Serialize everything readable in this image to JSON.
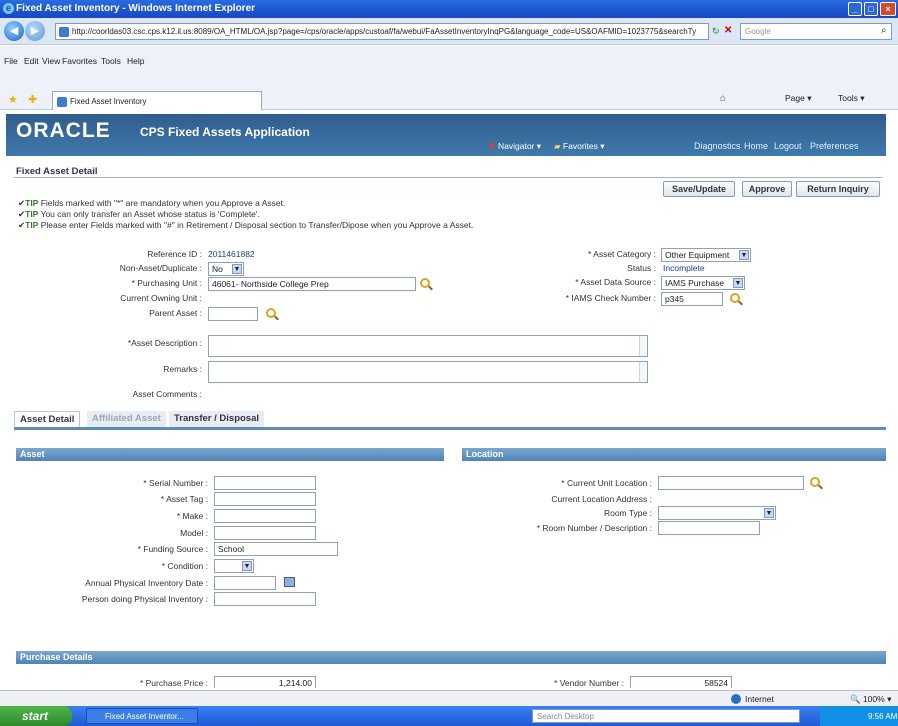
{
  "window": {
    "title": "Fixed Asset Inventory - Windows Internet Explorer"
  },
  "browser": {
    "url": "http://coorldas03.csc.cps.k12.il.us:8089/OA_HTML/OA.jsp?page=/cps/oracle/apps/custoaf/fa/webui/FaAssetInventoryInqPG&language_code=US&OAFMID=1023775&searchTy",
    "search_placeholder": "Google",
    "menu": [
      "File",
      "Edit",
      "View",
      "Favorites",
      "Tools",
      "Help"
    ],
    "tab_label": "Fixed Asset Inventory",
    "cmd_page": "Page",
    "cmd_tools": "Tools"
  },
  "banner": {
    "logo": "ORACLE",
    "app_name": "CPS Fixed Assets Application",
    "navigator": "Navigator",
    "favorites": "Favorites",
    "links": [
      "Diagnostics",
      "Home",
      "Logout",
      "Preferences"
    ]
  },
  "page": {
    "title": "Fixed Asset Detail",
    "buttons": {
      "save": "Save/Update",
      "approve": "Approve",
      "return": "Return Inquiry"
    },
    "tips": [
      {
        "tag": "TIP",
        "text": " Fields marked with \"*\" are mandatory when you Approve a Asset."
      },
      {
        "tag": "TIP",
        "text": " You can only transfer an Asset whose status is 'Complete'."
      },
      {
        "tag": "TIP",
        "text": " Please enter Fields marked with \"#\" in Retirement / Disposal section to Transfer/Dipose when you Approve a Asset."
      }
    ]
  },
  "header": {
    "reference_id_label": "Reference ID :",
    "reference_id": "2011461882",
    "non_asset_label": "Non-Asset/Duplicate :",
    "non_asset": "No",
    "purchasing_unit_label": "* Purchasing Unit :",
    "purchasing_unit": "46061- Northside College Prep",
    "owning_unit_label": "Current Owning Unit :",
    "parent_asset_label": "Parent Asset :",
    "category_label": "* Asset Category :",
    "category": "Other Equipment",
    "status_label": "Status :",
    "status": "Incomplete",
    "data_source_label": "* Asset Data Source :",
    "data_source": "IAMS Purchase",
    "check_label": "* IAMS Check Number :",
    "check": "p345",
    "description_label": "*Asset Description :",
    "remarks_label": "Remarks :",
    "comments_label": "Asset Comments :"
  },
  "tabs": [
    "Asset Detail",
    "Affiliated Asset",
    "Transfer / Disposal"
  ],
  "asset": {
    "heading": "Asset",
    "serial_label": "* Serial Number :",
    "tag_label": "* Asset Tag :",
    "make_label": "* Make :",
    "model_label": "Model :",
    "funding_label": "* Funding Source :",
    "funding": "School",
    "condition_label": "* Condition :",
    "inv_date_label": "Annual Physical Inventory Date :",
    "person_label": "Person doing Physical Inventory :"
  },
  "location": {
    "heading": "Location",
    "unit_label": "* Current Unit Location :",
    "address_label": "Current Location Address :",
    "room_type_label": "Room Type :",
    "room_number_label": "* Room Number / Description :"
  },
  "purchase": {
    "heading": "Purchase Details",
    "price_label": "* Purchase Price :",
    "price": "1,214.00",
    "vendor_label": "* Vendor Number :",
    "vendor": "58524"
  },
  "status_bar": {
    "zone": "Internet",
    "zoom": "100%"
  },
  "taskbar": {
    "start": "start",
    "task": "Fixed Asset Inventor...",
    "search": "Search Desktop",
    "time": "9:56 AM"
  }
}
